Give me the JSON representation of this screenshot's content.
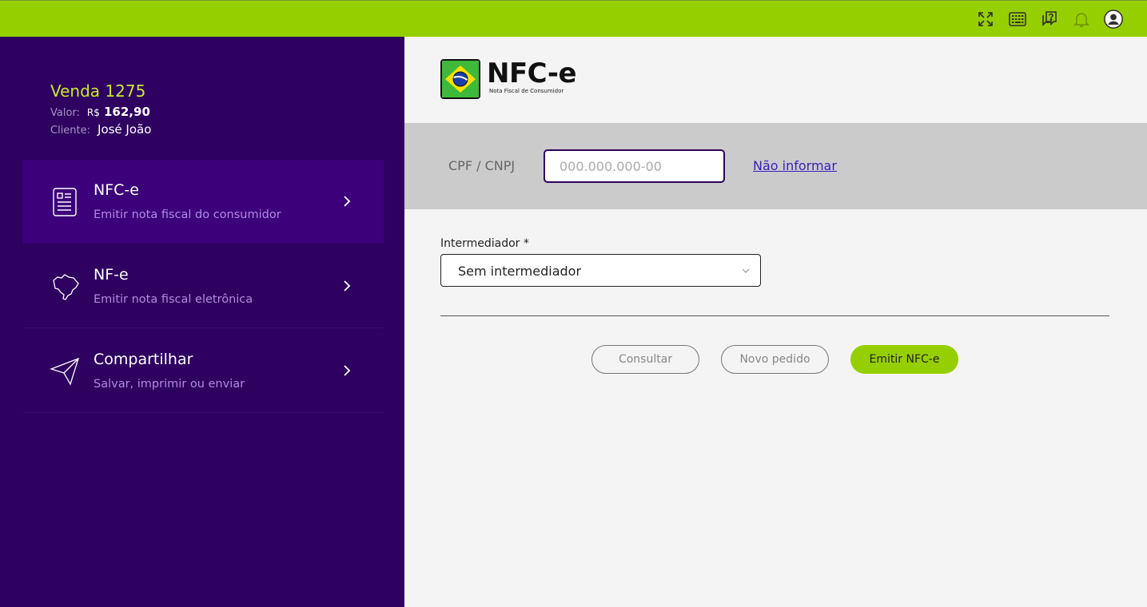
{
  "colors": {
    "topbar": "#96cf00",
    "sidebar": "#2e005f",
    "sidebar_active": "#3c007a",
    "accent_lime": "#c8e637",
    "primary_button": "#96cf00"
  },
  "topbar": {
    "icons": [
      "fullscreen-icon",
      "keypad-icon",
      "help-chat-icon",
      "bell-icon",
      "user-avatar-icon"
    ]
  },
  "sale": {
    "title": "Venda 1275",
    "value_label": "Valor:",
    "currency": "R$",
    "value": "162,90",
    "client_label": "Cliente:",
    "client": "José João"
  },
  "menu": {
    "items": [
      {
        "title": "NFC-e",
        "subtitle": "Emitir nota fiscal do consumidor",
        "icon": "receipt-icon",
        "active": true
      },
      {
        "title": "NF-e",
        "subtitle": "Emitir nota fiscal eletrônica",
        "icon": "brazil-map-icon",
        "active": false
      },
      {
        "title": "Compartilhar",
        "subtitle": "Salvar, imprimir ou enviar",
        "icon": "paper-plane-icon",
        "active": false
      }
    ]
  },
  "logo": {
    "title": "NFC-e",
    "subtitle": "Nota Fiscal de Consumidor"
  },
  "cpf": {
    "label": "CPF / CNPJ",
    "placeholder": "000.000.000-00",
    "value": "",
    "skip_link": "Não informar"
  },
  "intermediador": {
    "label": "Intermediador *",
    "selected": "Sem intermediador"
  },
  "actions": {
    "consultar": "Consultar",
    "novo_pedido": "Novo pedido",
    "emitir": "Emitir NFC-e"
  }
}
